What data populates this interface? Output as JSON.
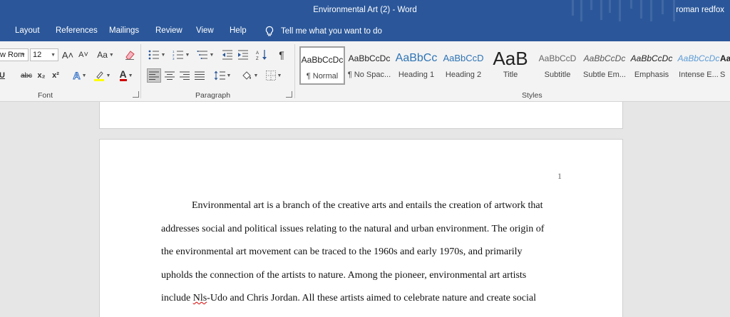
{
  "titlebar": {
    "title": "Environmental Art (2)  -  Word",
    "user": "roman redfox"
  },
  "tabs": [
    "Layout",
    "References",
    "Mailings",
    "Review",
    "View",
    "Help"
  ],
  "tell_me": "Tell me what you want to do",
  "font_group": {
    "label": "Font",
    "font_name": "w Rom",
    "font_size": "12",
    "grow": "A˄",
    "shrink": "A˅",
    "change_case": "Aa",
    "underline": "U",
    "strike": "abc",
    "subscript": "x₂",
    "superscript": "x²",
    "text_effects": "A",
    "font_color": "A",
    "highlight_color": "#ffff00",
    "font_color_value": "#d00000"
  },
  "paragraph_group": {
    "label": "Paragraph"
  },
  "styles_group": {
    "label": "Styles",
    "items": [
      {
        "sample": "AaBbCcDc",
        "name": "¶ Normal"
      },
      {
        "sample": "AaBbCcDc",
        "name": "¶ No Spac..."
      },
      {
        "sample": "AaBbCc",
        "name": "Heading 1"
      },
      {
        "sample": "AaBbCcD",
        "name": "Heading 2"
      },
      {
        "sample": "AaB",
        "name": "Title"
      },
      {
        "sample": "AaBbCcD",
        "name": "Subtitle"
      },
      {
        "sample": "AaBbCcDc",
        "name": "Subtle Em..."
      },
      {
        "sample": "AaBbCcDc",
        "name": "Emphasis"
      },
      {
        "sample": "AaBbCcDc",
        "name": "Intense E..."
      },
      {
        "sample": "Aa",
        "name": "S"
      }
    ]
  },
  "document": {
    "page_number": "1",
    "lines": [
      "Environmental art is a branch of the creative arts and entails the creation of artwork that",
      "addresses social and political issues relating to the natural and urban environment. The origin of",
      "the environmental art movement can be traced to the 1960s and early 1970s, and primarily",
      "upholds the connection of the artists to nature. Among the pioneer, environmental art artists"
    ],
    "last_line_pre": "include ",
    "misspelled_word": "Nls",
    "last_line_post": "-Udo and Chris Jordan. All these artists aimed to celebrate nature and create social"
  }
}
